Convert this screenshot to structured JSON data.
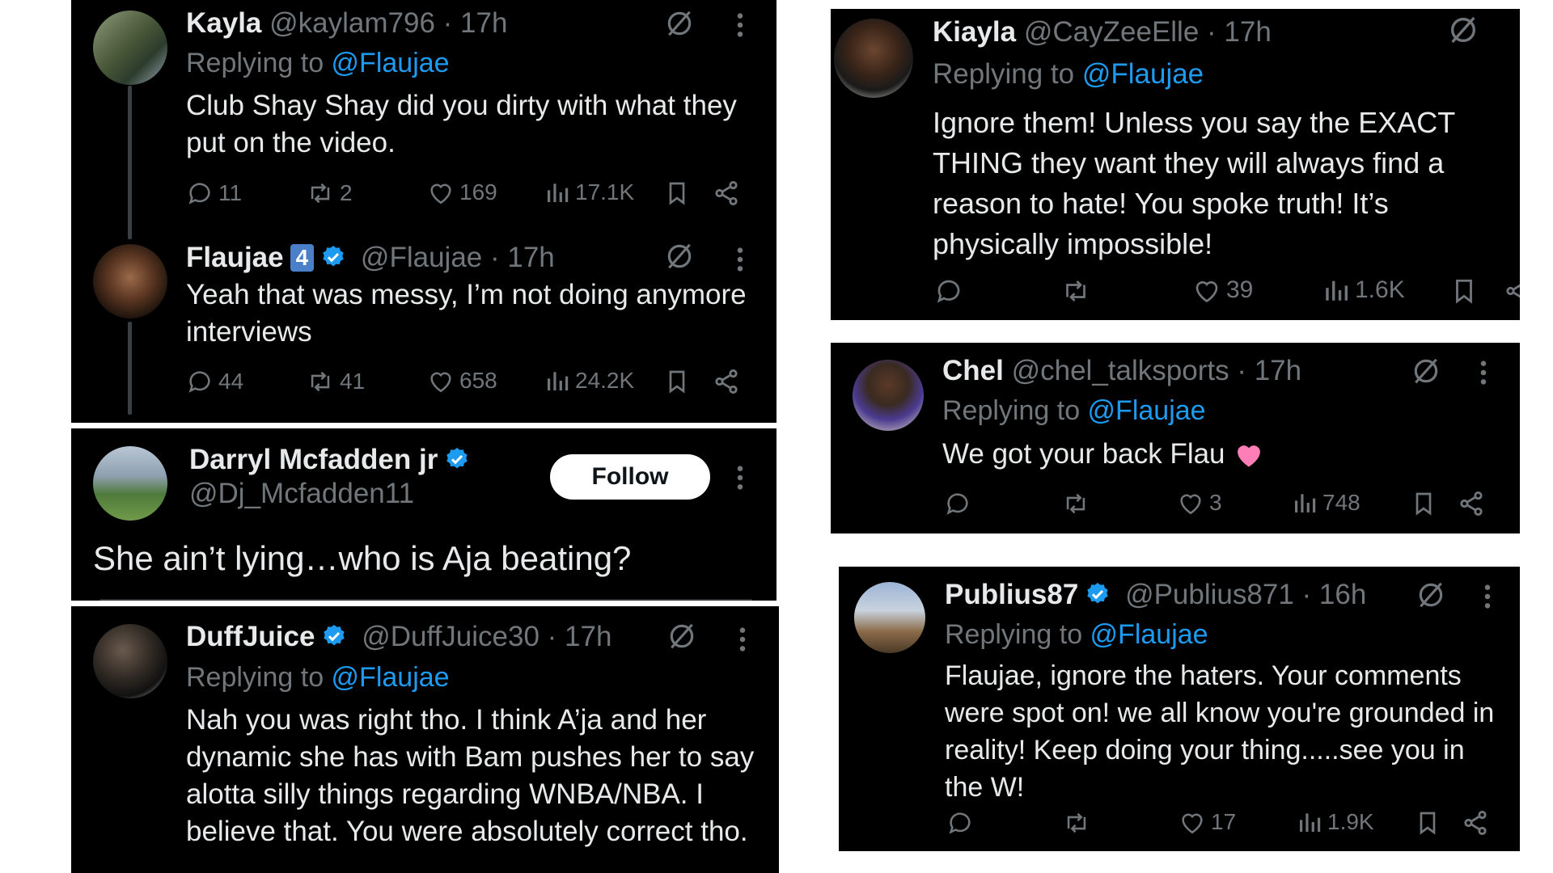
{
  "tweets": [
    {
      "name": "Kayla",
      "handle": "@kaylam796",
      "time": "· 17h",
      "reply_prefix": "Replying to ",
      "reply_to": "@Flaujae",
      "text": "Club Shay Shay did you dirty with what they put on the video.",
      "replies": "11",
      "reposts": "2",
      "likes": "169",
      "views": "17.1K"
    },
    {
      "name": "Flaujae",
      "badge": "4",
      "handle": "@Flaujae",
      "time": "· 17h",
      "text": "Yeah that was messy, I’m not doing anymore interviews",
      "replies": "44",
      "reposts": "41",
      "likes": "658",
      "views": "24.2K"
    },
    {
      "name": "Darryl Mcfadden jr",
      "handle": "@Dj_Mcfadden11",
      "follow": "Follow",
      "text": "She ain’t lying…who is Aja beating?"
    },
    {
      "name": "DuffJuice",
      "handle": "@DuffJuice30",
      "time": "· 17h",
      "reply_prefix": "Replying to ",
      "reply_to": "@Flaujae",
      "text": "Nah you was right tho. I think A’ja and her dynamic she has with Bam pushes her to say alotta silly things regarding WNBA/NBA. I believe that. You were absolutely correct tho."
    },
    {
      "name": "Kiayla",
      "handle": "@CayZeeElle",
      "time": "· 17h",
      "reply_prefix": "Replying to ",
      "reply_to": "@Flaujae",
      "text": "Ignore them! Unless you say the EXACT THING they want they will always find a reason to hate! You spoke truth! It’s physically impossible!",
      "likes": "39",
      "views": "1.6K"
    },
    {
      "name": "Chel",
      "handle": "@chel_talksports",
      "time": "· 17h",
      "reply_prefix": "Replying to ",
      "reply_to": "@Flaujae",
      "text": "We got your back Flau",
      "likes": "3",
      "views": "748"
    },
    {
      "name": "Publius87",
      "handle": "@Publius871",
      "time": "· 16h",
      "reply_prefix": "Replying to ",
      "reply_to": "@Flaujae",
      "text": "Flaujae, ignore the haters.  Your comments were spot on! we all know you're grounded in reality!  Keep doing your thing.....see you in the W!",
      "likes": "17",
      "views": "1.9K"
    }
  ],
  "colors": {
    "background": "#000000",
    "text": "#e7e9ea",
    "secondary": "#71767b",
    "link": "#1d9bf0",
    "verified": "#1d9bf0",
    "heart_emoji": "#ff7eb6"
  }
}
